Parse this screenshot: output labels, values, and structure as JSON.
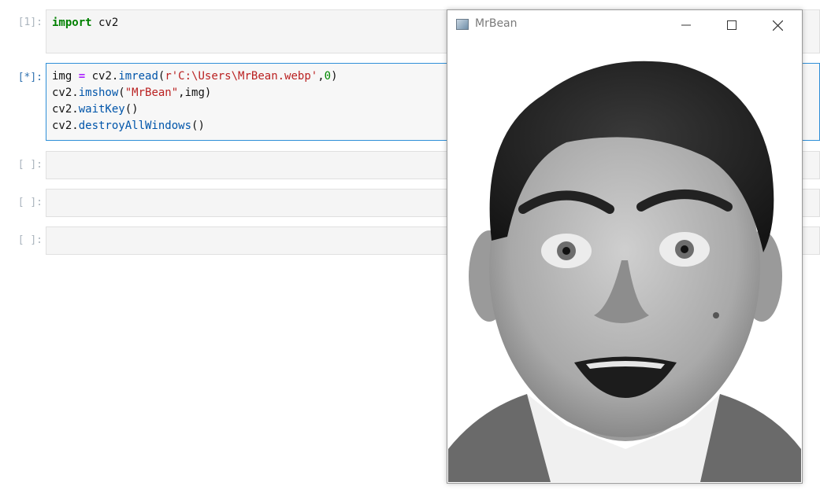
{
  "cells": [
    {
      "prompt": "[1]:",
      "lines": [
        [
          {
            "t": "import",
            "c": "kw"
          },
          {
            "t": " cv2",
            "c": ""
          }
        ]
      ]
    },
    {
      "prompt": "[*]:",
      "lines": [
        [
          {
            "t": "img ",
            "c": ""
          },
          {
            "t": "=",
            "c": "op"
          },
          {
            "t": " cv2.",
            "c": ""
          },
          {
            "t": "imread",
            "c": "fn"
          },
          {
            "t": "(",
            "c": ""
          },
          {
            "t": "r'C:\\Users\\MrBean.webp'",
            "c": "str"
          },
          {
            "t": ",",
            "c": ""
          },
          {
            "t": "0",
            "c": "num"
          },
          {
            "t": ")",
            "c": ""
          }
        ],
        [
          {
            "t": "cv2.",
            "c": ""
          },
          {
            "t": "imshow",
            "c": "fn"
          },
          {
            "t": "(",
            "c": ""
          },
          {
            "t": "\"MrBean\"",
            "c": "str"
          },
          {
            "t": ",img)",
            "c": ""
          }
        ],
        [
          {
            "t": "cv2.",
            "c": ""
          },
          {
            "t": "waitKey",
            "c": "fn"
          },
          {
            "t": "()",
            "c": ""
          }
        ],
        [
          {
            "t": "cv2.",
            "c": ""
          },
          {
            "t": "destroyAllWindows",
            "c": "fn"
          },
          {
            "t": "()",
            "c": ""
          }
        ]
      ]
    },
    {
      "prompt": "[ ]:",
      "lines": []
    },
    {
      "prompt": "[ ]:",
      "lines": []
    },
    {
      "prompt": "[ ]:",
      "lines": []
    }
  ],
  "window": {
    "title": "MrBean",
    "icon": "app-window-icon",
    "controls": [
      "minimize-icon",
      "maximize-icon",
      "close-icon"
    ],
    "content": "grayscale-portrait-image"
  }
}
